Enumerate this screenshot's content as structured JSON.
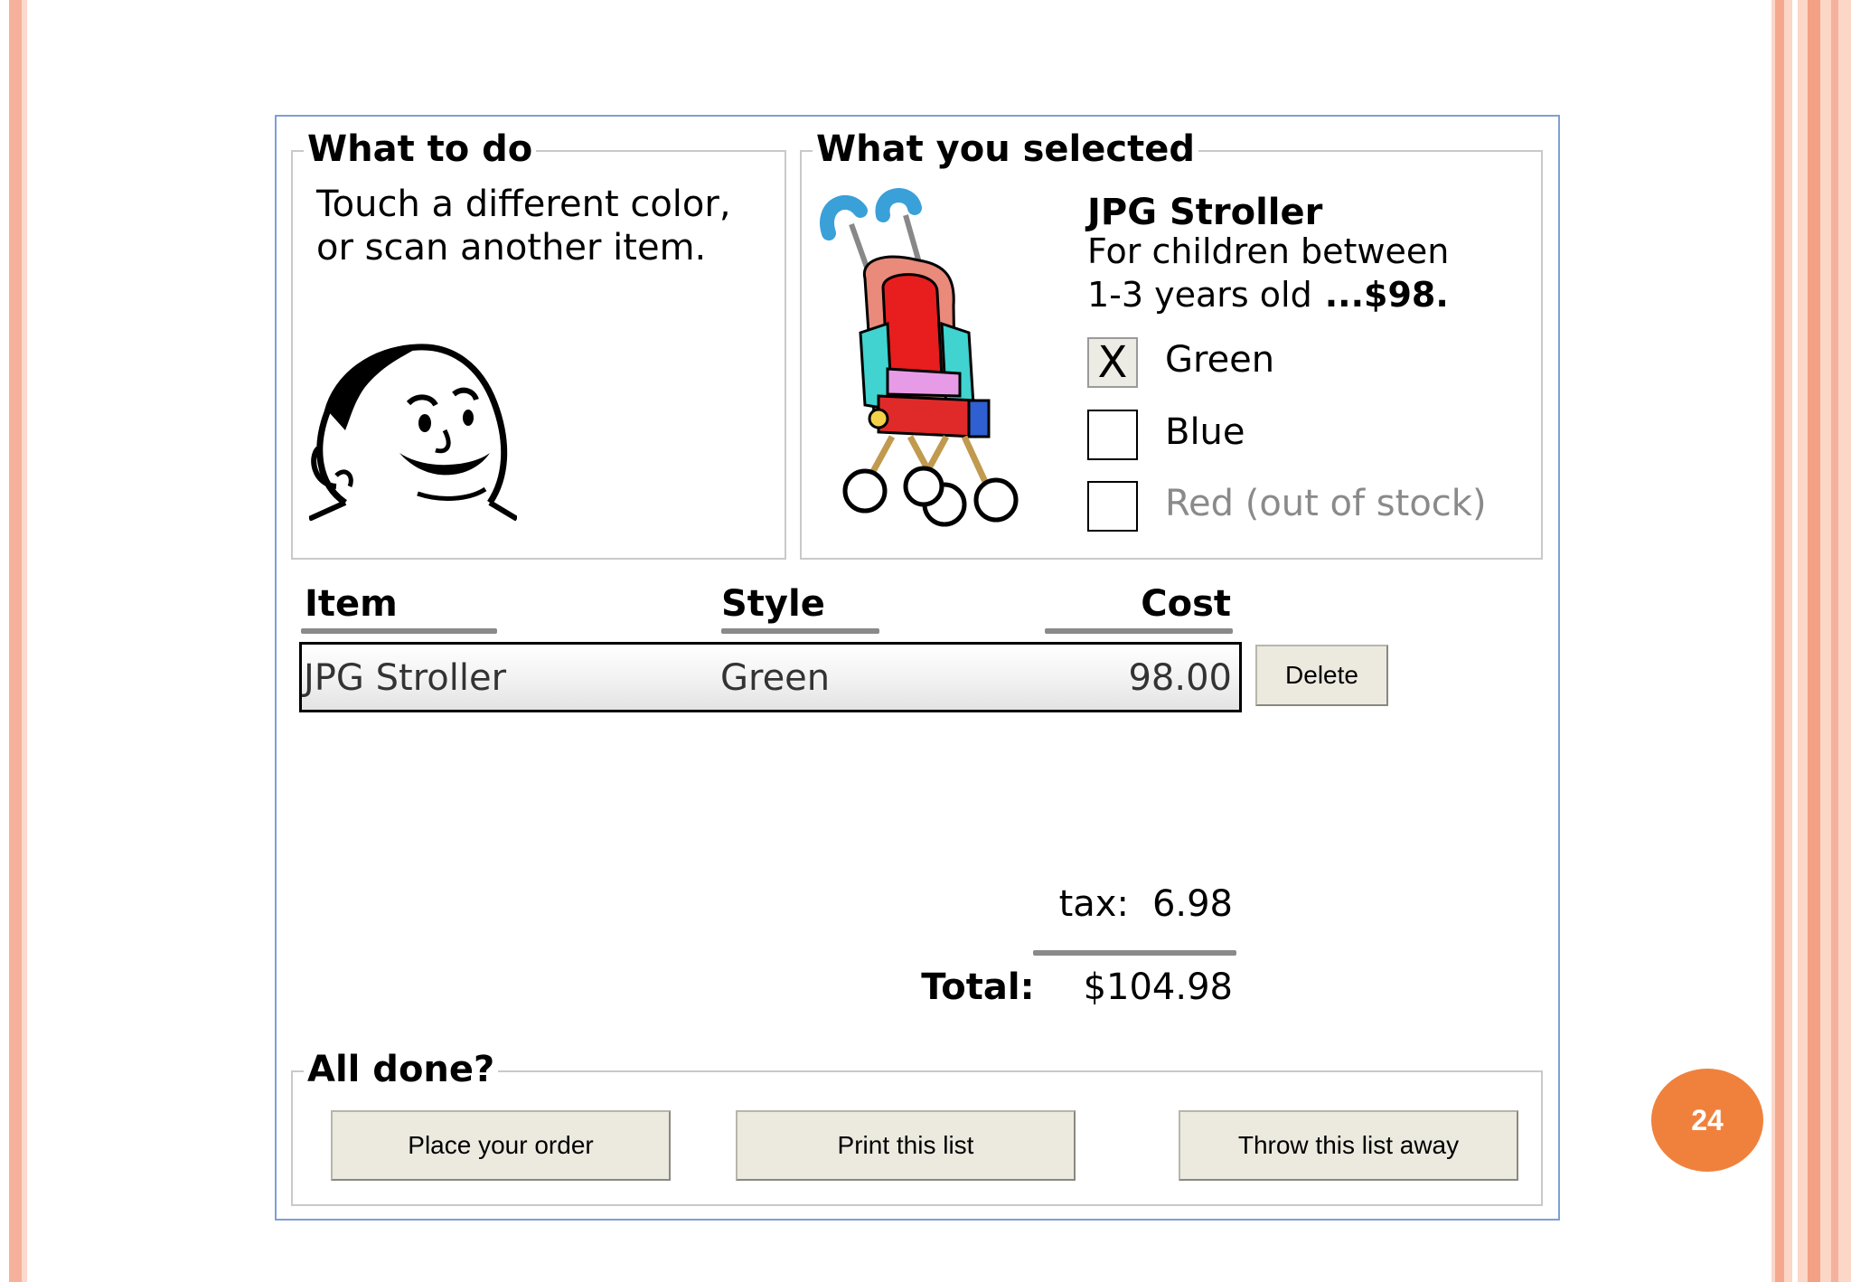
{
  "slide": {
    "page_number": "24"
  },
  "what_to_do": {
    "title": "What to do",
    "lines": [
      "Touch a different color,",
      "or scan another item."
    ]
  },
  "what_you_selected": {
    "title": "What you selected",
    "product_name": "JPG Stroller",
    "description_line1": "For children between",
    "description_line2": "1-3 years old",
    "price": "...$98.",
    "options": [
      {
        "label": "Green",
        "checked": true,
        "mark": "X",
        "available": true
      },
      {
        "label": "Blue",
        "checked": false,
        "mark": "",
        "available": true
      },
      {
        "label": "Red (out of stock)",
        "checked": false,
        "mark": "",
        "available": false
      }
    ]
  },
  "table": {
    "headers": {
      "item": "Item",
      "style": "Style",
      "cost": "Cost"
    },
    "rows": [
      {
        "item": "JPG Stroller",
        "style": "Green",
        "cost": "98.00",
        "delete_label": "Delete"
      }
    ]
  },
  "totals": {
    "tax_label": "tax:",
    "tax_value": "6.98",
    "total_label": "Total:",
    "total_value": "$104.98"
  },
  "all_done": {
    "title": "All done?",
    "buttons": [
      "Place your order",
      "Print this list",
      "Throw this list away"
    ]
  },
  "colors": {
    "window_border": "#7f9fd6",
    "page_badge": "#f0813d",
    "slide_accent": "#f6b19c",
    "button_face": "#ece9df",
    "disabled_text": "#8a8a8a"
  }
}
